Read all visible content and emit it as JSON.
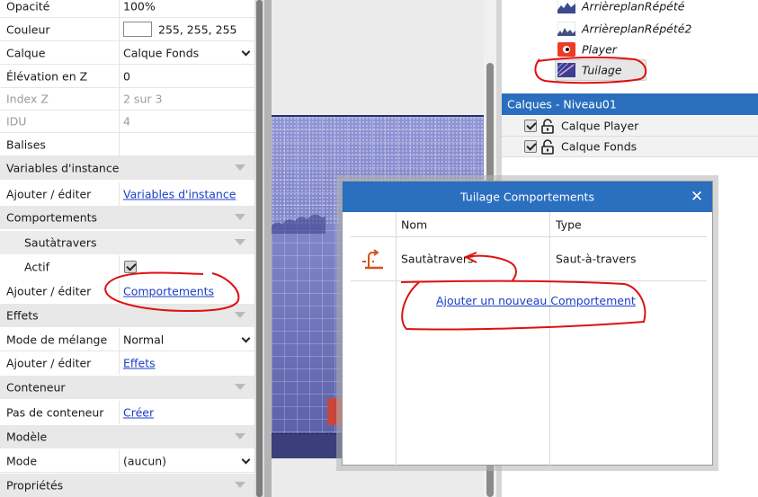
{
  "properties": {
    "opacity": {
      "label": "Opacité",
      "value": "100%"
    },
    "color": {
      "label": "Couleur",
      "value": "255, 255, 255",
      "swatch": "#ffffff"
    },
    "layer": {
      "label": "Calque",
      "value": "Calque Fonds"
    },
    "z_elevation": {
      "label": "Élévation en Z",
      "value": "0"
    },
    "z_index": {
      "label": "Index Z",
      "value": "2 sur 3"
    },
    "idu": {
      "label": "IDU",
      "value": "4"
    },
    "tags": {
      "label": "Balises",
      "value": ""
    },
    "instance_vars_group": {
      "label": "Variables d'instance"
    },
    "instance_vars_edit": {
      "label": "Ajouter / éditer",
      "link": "Variables d'instance"
    },
    "behaviors_group": {
      "label": "Comportements"
    },
    "behavior_sub_group": {
      "label": "Sautàtravers"
    },
    "active": {
      "label": "Actif",
      "checked": true
    },
    "behaviors_edit": {
      "label": "Ajouter / éditer",
      "link": "Comportements"
    },
    "effects_group": {
      "label": "Effets"
    },
    "blend_mode": {
      "label": "Mode de mélange",
      "value": "Normal"
    },
    "effects_edit": {
      "label": "Ajouter / éditer",
      "link": "Effets"
    },
    "container_group": {
      "label": "Conteneur"
    },
    "no_container": {
      "label": "Pas de conteneur",
      "link": "Créer"
    },
    "template_group": {
      "label": "Modèle"
    },
    "mode": {
      "label": "Mode",
      "value": "(aucun)"
    },
    "properties_group": {
      "label": "Propriétés"
    }
  },
  "objects": [
    {
      "name": "ArrièreplanRépété",
      "icon": "background-repeat-icon"
    },
    {
      "name": "ArrièreplanRépété2",
      "icon": "background-repeat-icon"
    },
    {
      "name": "Player",
      "icon": "player-sprite-icon"
    },
    {
      "name": "Tuilage",
      "icon": "tilemap-icon",
      "selected": true
    }
  ],
  "layers_panel": {
    "title": "Calques - Niveau01",
    "layers": [
      {
        "name": "Calque Player",
        "visible": true,
        "locked": false
      },
      {
        "name": "Calque Fonds",
        "visible": true,
        "locked": false
      }
    ]
  },
  "dialog": {
    "title": "Tuilage Comportements",
    "columns": {
      "name": "Nom",
      "type": "Type"
    },
    "behaviors": [
      {
        "name": "Sautàtravers",
        "type": "Saut-à-travers",
        "icon": "jump-thru-icon"
      }
    ],
    "add_link": "Ajouter un nouveau Comportement"
  },
  "colors": {
    "accent": "#2b6fbf",
    "link": "#1a3ec8",
    "annotation": "#e01010",
    "group_bg": "#e8e8e8"
  }
}
